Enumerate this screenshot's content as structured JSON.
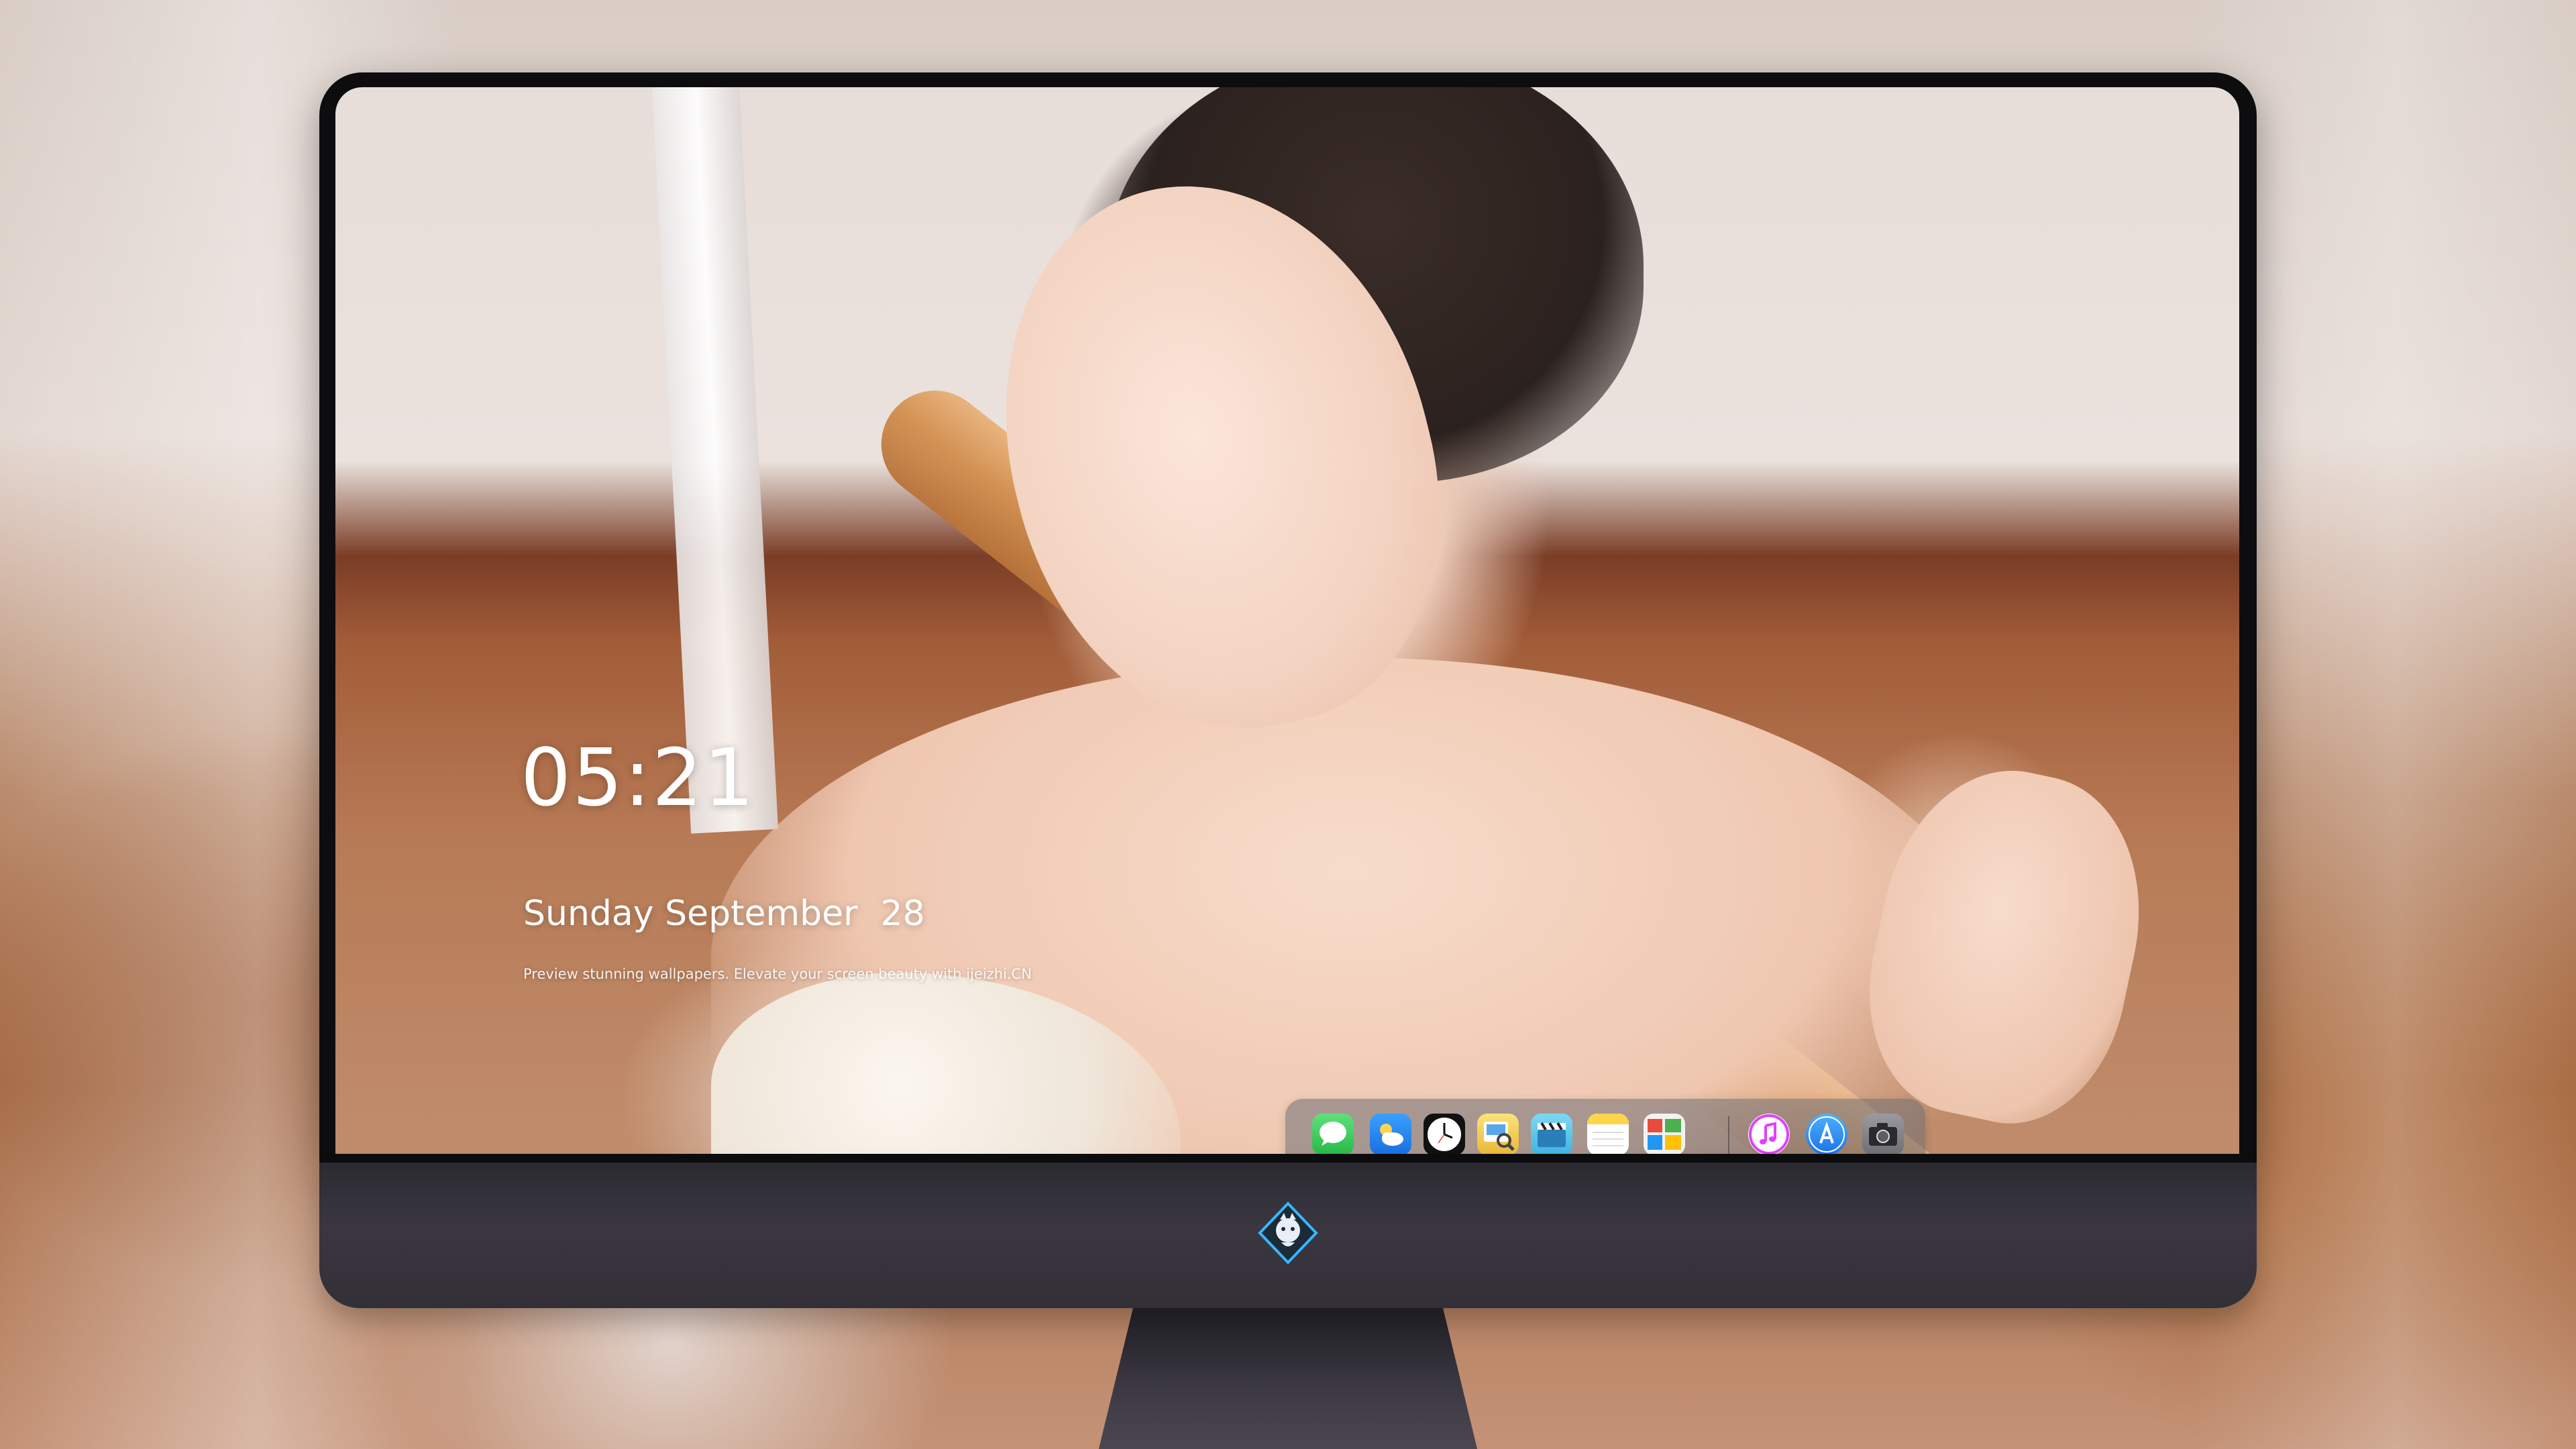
{
  "lock_screen": {
    "time": "05:21",
    "day": "Sunday",
    "month": "September",
    "date": "28",
    "tagline": "Preview stunning wallpapers. Elevate your screen beauty with ijeizhi.CN"
  },
  "dock": {
    "apps": [
      {
        "name": "Messages",
        "icon": "message-bubble-icon",
        "color": "#34c759"
      },
      {
        "name": "Weather",
        "icon": "cloud-sun-icon",
        "color": "#2f8ef0"
      },
      {
        "name": "Clock",
        "icon": "clock-icon",
        "color": "#111111"
      },
      {
        "name": "Preview",
        "icon": "photo-magnifier-icon",
        "color": "#f4c542"
      },
      {
        "name": "Clips",
        "icon": "clapperboard-icon",
        "color": "#4fc3e8"
      },
      {
        "name": "Notes",
        "icon": "notepad-icon",
        "color": "#ffd54a"
      },
      {
        "name": "Photo Booth",
        "icon": "photo-collage-icon",
        "color": "#e84b3a"
      },
      {
        "name": "iTunes",
        "icon": "music-note-icon",
        "color": "#e040fb"
      },
      {
        "name": "App Store",
        "icon": "app-store-icon",
        "color": "#1e90ff"
      },
      {
        "name": "Camera",
        "icon": "camera-icon",
        "color": "#8e8e93"
      }
    ]
  },
  "colors": {
    "bezel": "#0d0d0f",
    "chin": "#35323b",
    "text": "#ffffff"
  }
}
